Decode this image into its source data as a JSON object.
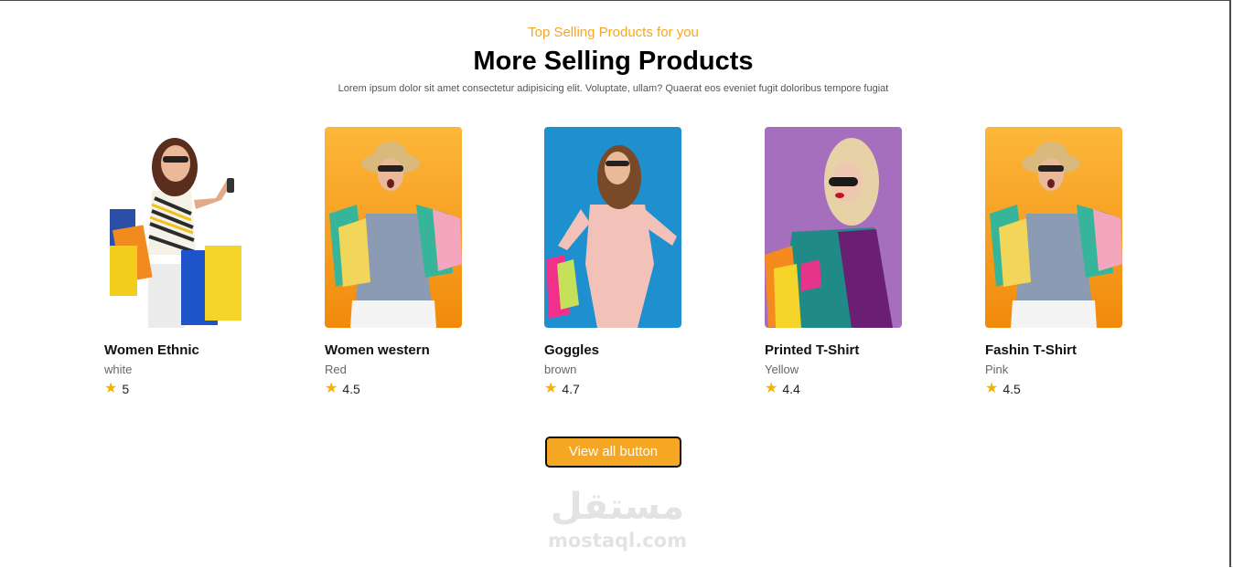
{
  "section": {
    "subtitle": "Top Selling Products for you",
    "title": "More Selling Products",
    "description": "Lorem ipsum dolor sit amet consectetur adipisicing elit. Voluptate, ullam? Quaerat eos eveniet fugit doloribus tempore fugiat"
  },
  "products": [
    {
      "name": "Women Ethnic",
      "color": "white",
      "rating": "5",
      "background": "#ffffff"
    },
    {
      "name": "Women western",
      "color": "Red",
      "rating": "4.5",
      "background": "#fbb034"
    },
    {
      "name": "Goggles",
      "color": "brown",
      "rating": "4.7",
      "background": "#1e8fcf"
    },
    {
      "name": "Printed T-Shirt",
      "color": "Yellow",
      "rating": "4.4",
      "background": "#a56fbd"
    },
    {
      "name": "Fashin T-Shirt",
      "color": "Pink",
      "rating": "4.5",
      "background": "#fbb034"
    }
  ],
  "star_icon": "star-icon",
  "star_color": "#f2b400",
  "accent_color": "#f5a623",
  "view_all_label": "View all button",
  "watermark": {
    "arabic": "مستقل",
    "latin": "mostaql.com"
  }
}
